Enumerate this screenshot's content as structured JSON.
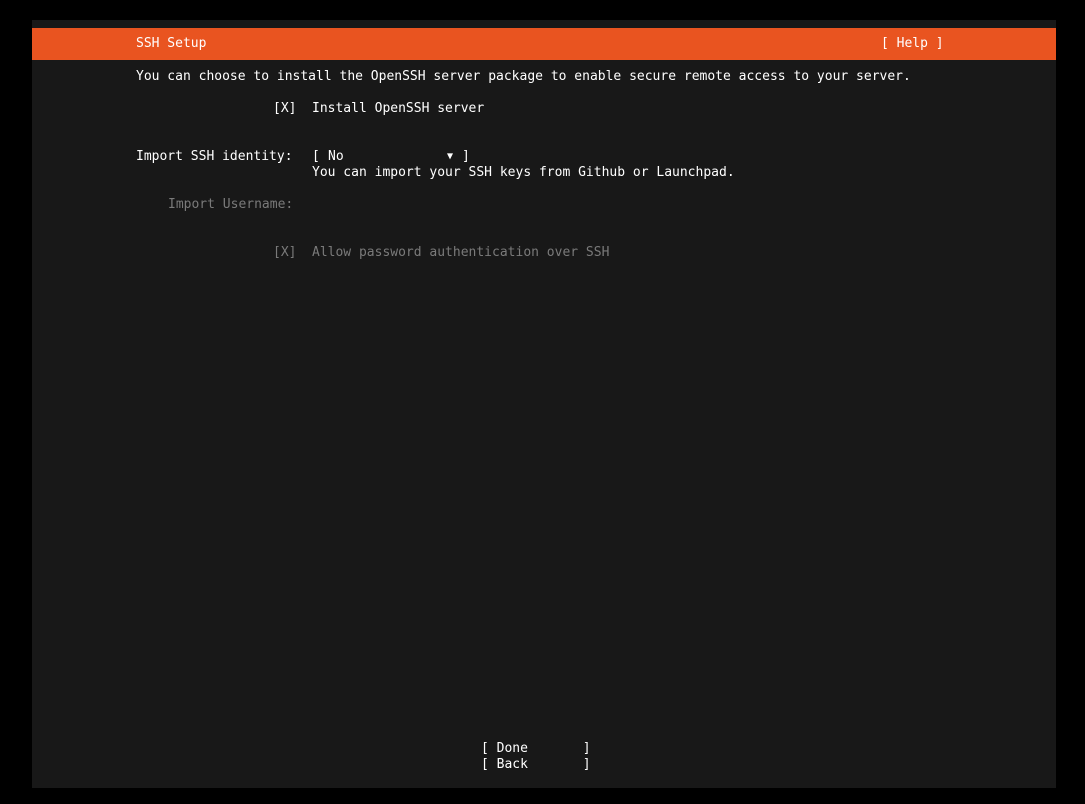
{
  "header": {
    "title": "SSH Setup",
    "help_label": "[ Help ]"
  },
  "intro": "You can choose to install the OpenSSH server package to enable secure remote access to your server.",
  "install_openssh": {
    "checkbox": "[X]",
    "label": "Install OpenSSH server"
  },
  "import_identity": {
    "label": "Import SSH identity:",
    "open_bracket": "[",
    "value": "No",
    "dropdown_arrow": "▼",
    "close_bracket": "]",
    "hint": "You can import your SSH keys from Github or Launchpad."
  },
  "import_username": {
    "label": "Import Username:"
  },
  "password_auth": {
    "checkbox": "[X]",
    "label": "Allow password authentication over SSH"
  },
  "buttons": {
    "done": "[ Done       ]",
    "back": "[ Back       ]"
  },
  "colors": {
    "accent": "#e95420",
    "background": "#181818",
    "dimmed_text": "#7a7a7a"
  }
}
